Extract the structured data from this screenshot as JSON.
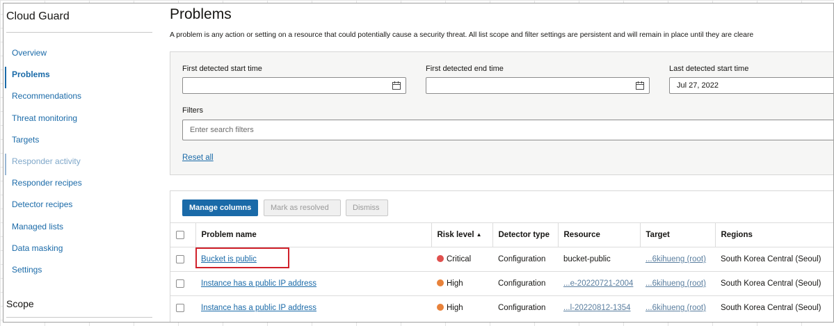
{
  "sidebar": {
    "title": "Cloud Guard",
    "items": [
      {
        "label": "Overview",
        "state": "normal"
      },
      {
        "label": "Problems",
        "state": "active"
      },
      {
        "label": "Recommendations",
        "state": "normal"
      },
      {
        "label": "Threat monitoring",
        "state": "normal"
      },
      {
        "label": "Targets",
        "state": "normal"
      },
      {
        "label": "Responder activity",
        "state": "disabled"
      },
      {
        "label": "Responder recipes",
        "state": "normal"
      },
      {
        "label": "Detector recipes",
        "state": "normal"
      },
      {
        "label": "Managed lists",
        "state": "normal"
      },
      {
        "label": "Data masking",
        "state": "normal"
      },
      {
        "label": "Settings",
        "state": "normal"
      }
    ],
    "scope_title": "Scope"
  },
  "page": {
    "title": "Problems",
    "description": "A problem is any action or setting on a resource that could potentially cause a security threat. All list scope and filter settings are persistent and will remain in place until they are cleare"
  },
  "filters": {
    "first_detected_start": {
      "label": "First detected start time",
      "value": ""
    },
    "first_detected_end": {
      "label": "First detected end time",
      "value": ""
    },
    "last_detected_start": {
      "label": "Last detected start time",
      "value": "Jul 27, 2022"
    },
    "filters_label": "Filters",
    "search_placeholder": "Enter search filters",
    "reset_label": "Reset all"
  },
  "toolbar": {
    "manage_columns": "Manage columns",
    "mark_resolved": "Mark as resolved",
    "dismiss": "Dismiss"
  },
  "table": {
    "columns": [
      "Problem name",
      "Risk level",
      "Detector type",
      "Resource",
      "Target",
      "Regions"
    ],
    "sort_indicator": "▲",
    "rows": [
      {
        "name": "Bucket is public",
        "risk": "Critical",
        "detector": "Configuration",
        "resource": "bucket-public",
        "target": "...6kihueng (root)",
        "region": "South Korea Central (Seoul)"
      },
      {
        "name": "Instance has a public IP address",
        "risk": "High",
        "detector": "Configuration",
        "resource": "...e-20220721-2004",
        "target": "...6kihueng (root)",
        "region": "South Korea Central (Seoul)"
      },
      {
        "name": "Instance has a public IP address",
        "risk": "High",
        "detector": "Configuration",
        "resource": "...l-20220812-1354",
        "target": "...6kihueng (root)",
        "region": "South Korea Central (Seoul)"
      }
    ]
  },
  "colors": {
    "critical": "#e0504e",
    "high": "#e8823a",
    "accent": "#1a6aa8",
    "highlight": "#d0202a"
  }
}
